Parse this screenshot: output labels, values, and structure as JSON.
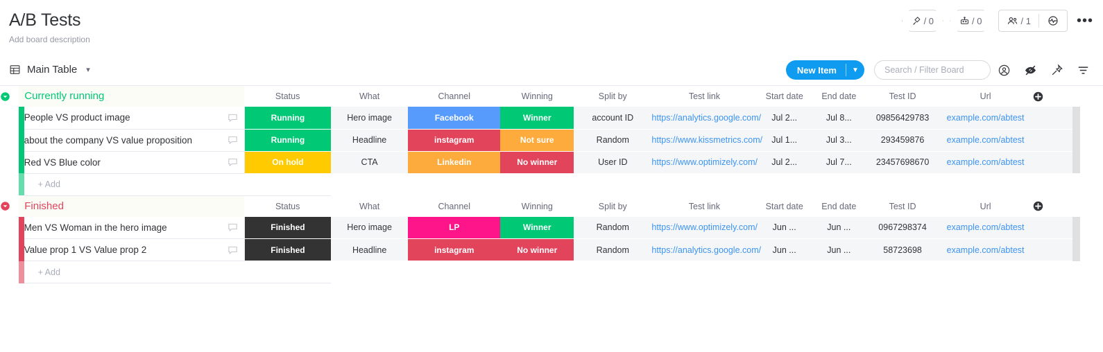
{
  "header": {
    "title": "A/B Tests",
    "description": "Add board description",
    "integrations_count": "/ 0",
    "automations_count": "/ 0",
    "members_count": "/ 1",
    "more_label": "•••"
  },
  "toolbar": {
    "view_label": "Main Table",
    "new_item_label": "New Item",
    "search_placeholder": "Search / Filter Board"
  },
  "columns": [
    "Status",
    "What",
    "Channel",
    "Winning",
    "Split by",
    "Test link",
    "Start date",
    "End date",
    "Test ID",
    "Url"
  ],
  "add_row_label": "+ Add",
  "colors": {
    "green": "#00c875",
    "yellow": "#ffcb00",
    "blue": "#579bfc",
    "red": "#e2445c",
    "orange": "#fdab3d",
    "dark": "#333333",
    "pink": "#ff158a",
    "link": "#3c94f2",
    "accent_blue": "#0f9bf0"
  },
  "groups": [
    {
      "name": "Currently running",
      "color": "#00c875",
      "rows": [
        {
          "name": "People VS product image",
          "status": {
            "label": "Running",
            "color": "#00c875"
          },
          "what": "Hero image",
          "channel": {
            "label": "Facebook",
            "color": "#579bfc"
          },
          "winning": {
            "label": "Winner",
            "color": "#00c875"
          },
          "split_by": "account ID",
          "test_link": "https://analytics.google.com/",
          "start_date": "Jul 2...",
          "end_date": "Jul 8...",
          "test_id": "09856429783",
          "url": "example.com/abtest"
        },
        {
          "name": "about the company VS value proposition",
          "status": {
            "label": "Running",
            "color": "#00c875"
          },
          "what": "Headline",
          "channel": {
            "label": "instagram",
            "color": "#e2445c"
          },
          "winning": {
            "label": "Not sure",
            "color": "#fdab3d"
          },
          "split_by": "Random",
          "test_link": "https://www.kissmetrics.com/",
          "start_date": "Jul 1...",
          "end_date": "Jul 3...",
          "test_id": "293459876",
          "url": "example.com/abtest"
        },
        {
          "name": "Red VS Blue color",
          "status": {
            "label": "On hold",
            "color": "#ffcb00"
          },
          "what": "CTA",
          "channel": {
            "label": "Linkedin",
            "color": "#fdab3d"
          },
          "winning": {
            "label": "No winner",
            "color": "#e2445c"
          },
          "split_by": "User ID",
          "test_link": "https://www.optimizely.com/",
          "start_date": "Jul 2...",
          "end_date": "Jul 7...",
          "test_id": "23457698670",
          "url": "example.com/abtest"
        }
      ]
    },
    {
      "name": "Finished",
      "color": "#e2445c",
      "rows": [
        {
          "name": "Men VS Woman in the hero image",
          "status": {
            "label": "Finished",
            "color": "#333333"
          },
          "what": "Hero image",
          "channel": {
            "label": "LP",
            "color": "#ff158a"
          },
          "winning": {
            "label": "Winner",
            "color": "#00c875"
          },
          "split_by": "Random",
          "test_link": "https://www.optimizely.com/",
          "start_date": "Jun ...",
          "end_date": "Jun ...",
          "test_id": "0967298374",
          "url": "example.com/abtest"
        },
        {
          "name": "Value prop 1 VS Value prop 2",
          "status": {
            "label": "Finished",
            "color": "#333333"
          },
          "what": "Headline",
          "channel": {
            "label": "instagram",
            "color": "#e2445c"
          },
          "winning": {
            "label": "No winner",
            "color": "#e2445c"
          },
          "split_by": "Random",
          "test_link": "https://analytics.google.com/",
          "start_date": "Jun ...",
          "end_date": "Jun ...",
          "test_id": "58723698",
          "url": "example.com/abtest"
        }
      ]
    }
  ]
}
